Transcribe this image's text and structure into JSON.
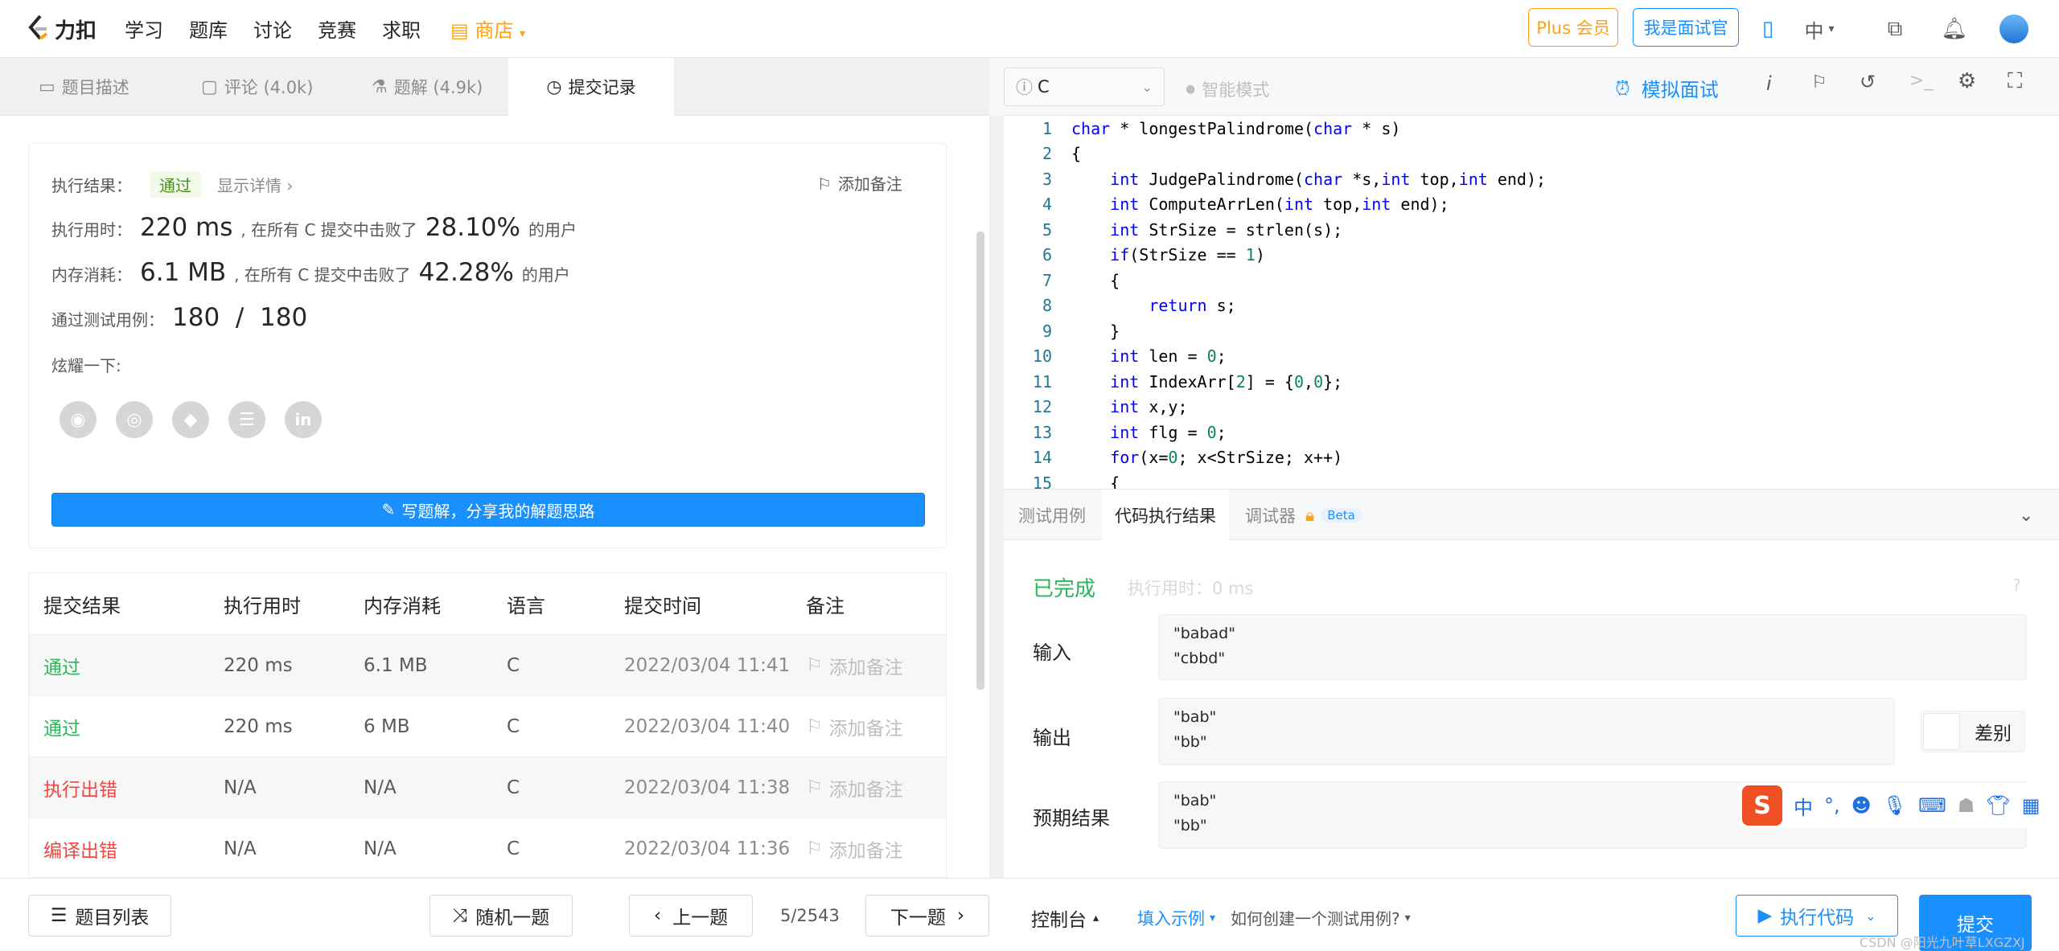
{
  "nav": {
    "brand": "力扣",
    "items": [
      "学习",
      "题库",
      "讨论",
      "竞赛",
      "求职"
    ],
    "shop": "商店",
    "plus": "Plus 会员",
    "interviewer": "我是面试官",
    "lang": "中"
  },
  "left_tabs": [
    {
      "label": "题目描述",
      "icon": "document-icon"
    },
    {
      "label": "评论 (4.0k)",
      "icon": "comment-icon"
    },
    {
      "label": "题解 (4.9k)",
      "icon": "flask-icon"
    },
    {
      "label": "提交记录",
      "icon": "clock-icon"
    }
  ],
  "result_card": {
    "result_label": "执行结果：",
    "result_value": "通过",
    "details": "显示详情",
    "add_note": "添加备注",
    "time_label": "执行用时：",
    "time_value": "220 ms",
    "time_mid": ", 在所有 C 提交中击败了",
    "time_pct": "28.10%",
    "time_end": "的用户",
    "mem_label": "内存消耗：",
    "mem_value": "6.1 MB",
    "mem_mid": ", 在所有 C 提交中击败了",
    "mem_pct": "42.28%",
    "mem_end": "的用户",
    "cases_label": "通过测试用例：",
    "cases_value": "180  /  180",
    "share_label": "炫耀一下:",
    "write_btn": "写题解，分享我的解题思路"
  },
  "table": {
    "headers": [
      "提交结果",
      "执行用时",
      "内存消耗",
      "语言",
      "提交时间",
      "备注"
    ],
    "rows": [
      {
        "status": "通过",
        "time": "220 ms",
        "mem": "6.1 MB",
        "lang": "C",
        "date": "2022/03/04 11:41",
        "note": "添加备注"
      },
      {
        "status": "通过",
        "time": "220 ms",
        "mem": "6 MB",
        "lang": "C",
        "date": "2022/03/04 11:40",
        "note": "添加备注"
      },
      {
        "status": "执行出错",
        "time": "N/A",
        "mem": "N/A",
        "lang": "C",
        "date": "2022/03/04 11:38",
        "note": "添加备注"
      },
      {
        "status": "编译出错",
        "time": "N/A",
        "mem": "N/A",
        "lang": "C",
        "date": "2022/03/04 11:36",
        "note": "添加备注"
      }
    ]
  },
  "editor": {
    "language": "C",
    "smart_mode": "智能模式",
    "mock": "模拟面试",
    "lines": [
      "char * longestPalindrome(char * s)",
      "{",
      "    int JudgePalindrome(char *s,int top,int end);",
      "    int ComputeArrLen(int top,int end);",
      "    int StrSize = strlen(s);",
      "    if(StrSize == 1)",
      "    {",
      "        return s;",
      "    }",
      "    int len = 0;",
      "    int IndexArr[2] = {0,0};",
      "    int x,y;",
      "    int flg = 0;",
      "    for(x=0; x<StrSize; x++)",
      "    {"
    ]
  },
  "bottom_tabs": [
    "测试用例",
    "代码执行结果",
    "调试器",
    "Beta"
  ],
  "run_result": {
    "status": "已完成",
    "time": "执行用时：0 ms",
    "input_label": "输入",
    "input": "\"babad\"\n\"cbbd\"",
    "output_label": "输出",
    "output": "\"bab\"\n\"bb\"",
    "diff": "差别",
    "expected_label": "预期结果",
    "expected": "\"bab\"\n\"bb\""
  },
  "footer": {
    "problem_list": "题目列表",
    "random": "随机一题",
    "prev": "上一题",
    "page": "5/2543",
    "next": "下一题",
    "console": "控制台",
    "fill_example": "填入示例",
    "how_create": "如何创建一个测试用例?",
    "run": "执行代码",
    "submit": "提交"
  },
  "watermark": "CSDN @阳光九叶草LXGZXJ",
  "colors": {
    "blue": "#1a90ff",
    "green": "#2db55d",
    "red": "#ef4743",
    "orange": "#ffa116"
  }
}
